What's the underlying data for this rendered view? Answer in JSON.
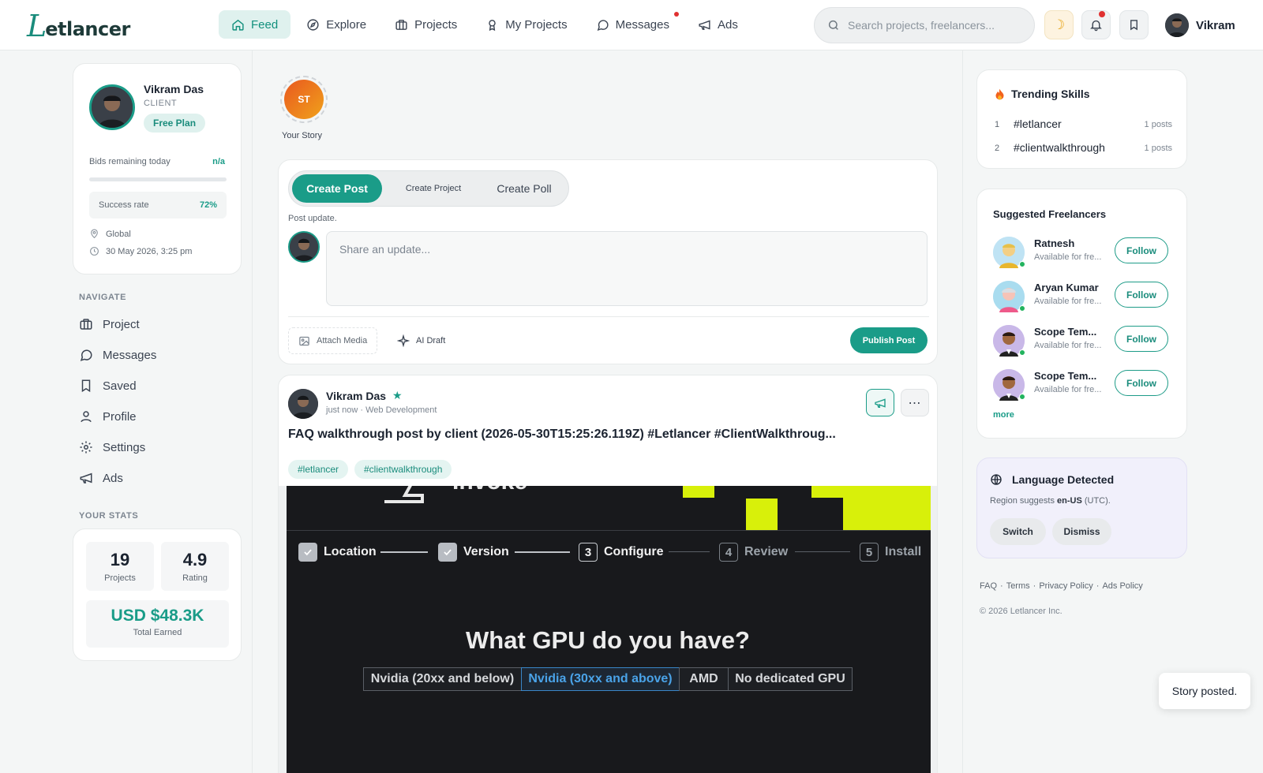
{
  "app": {
    "name": "Letlancer",
    "logo_initial": "L",
    "logo_rest": "etlancer"
  },
  "nav": {
    "items": [
      {
        "label": "Feed",
        "icon": "home-icon",
        "active": true
      },
      {
        "label": "Explore",
        "icon": "compass-icon"
      },
      {
        "label": "Projects",
        "icon": "briefcase-icon"
      },
      {
        "label": "My Projects",
        "icon": "award-icon"
      },
      {
        "label": "Messages",
        "icon": "chat-icon",
        "notification_dot": true
      },
      {
        "label": "Ads",
        "icon": "megaphone-icon"
      }
    ]
  },
  "search": {
    "placeholder": "Search projects, freelancers..."
  },
  "top_user": {
    "name": "Vikram"
  },
  "profile": {
    "name": "Vikram Das",
    "role": "CLIENT",
    "plan": "Free Plan",
    "bids_label": "Bids remaining today",
    "bids_value": "n/a",
    "success_label": "Success rate",
    "success_value": "72%",
    "location": "Global",
    "datetime": "30 May 2026, 3:25 pm"
  },
  "sidebar": {
    "navigate_title": "NAVIGATE",
    "items": [
      {
        "label": "Project",
        "icon": "briefcase-icon"
      },
      {
        "label": "Messages",
        "icon": "chat-icon"
      },
      {
        "label": "Saved",
        "icon": "bookmark-icon"
      },
      {
        "label": "Profile",
        "icon": "user-icon"
      },
      {
        "label": "Settings",
        "icon": "gear-icon"
      },
      {
        "label": "Ads",
        "icon": "megaphone-icon"
      }
    ],
    "stats_title": "YOUR STATS",
    "stats": {
      "projects_value": "19",
      "projects_label": "Projects",
      "rating_value": "4.9",
      "rating_label": "Rating",
      "earned_value": "USD $48.3K",
      "earned_label": "Total Earned"
    }
  },
  "story": {
    "initials": "ST",
    "label": "Your Story"
  },
  "composer": {
    "tabs": [
      "Create Post",
      "Create Project",
      "Create Poll"
    ],
    "hint": "Post update.",
    "placeholder": "Share an update...",
    "attach_label": "Attach Media",
    "ai_label": "AI Draft",
    "publish_label": "Publish Post"
  },
  "post": {
    "author": "Vikram Das",
    "meta": "just now · Web Development",
    "title": "FAQ walkthrough post by client (2026-05-30T15:25:26.119Z) #Letlancer #ClientWalkthroug...",
    "tags": [
      "#letlancer",
      "#clientwalkthrough"
    ],
    "image": {
      "brand_text": "Invoke",
      "steps": [
        {
          "label": "Location",
          "state": "done"
        },
        {
          "label": "Version",
          "state": "done"
        },
        {
          "num": "3",
          "label": "Configure",
          "state": "current"
        },
        {
          "num": "4",
          "label": "Review",
          "state": "todo"
        },
        {
          "num": "5",
          "label": "Install",
          "state": "todo"
        }
      ],
      "question": "What GPU do you have?",
      "options": [
        "Nvidia (20xx and below)",
        "Nvidia (30xx and above)",
        "AMD",
        "No dedicated GPU"
      ],
      "selected_option": "Nvidia (30xx and above)"
    }
  },
  "trending": {
    "title": "Trending Skills",
    "items": [
      {
        "rank": "1",
        "tag": "#letlancer",
        "count": "1 posts"
      },
      {
        "rank": "2",
        "tag": "#clientwalkthrough",
        "count": "1 posts"
      }
    ]
  },
  "suggested": {
    "title": "Suggested Freelancers",
    "items": [
      {
        "name": "Ratnesh",
        "status": "Available for fre...",
        "follow": "Follow"
      },
      {
        "name": "Aryan Kumar",
        "status": "Available for fre...",
        "follow": "Follow"
      },
      {
        "name": "Scope Tem...",
        "status": "Available for fre...",
        "follow": "Follow"
      },
      {
        "name": "Scope Tem...",
        "status": "Available for fre...",
        "follow": "Follow"
      }
    ],
    "more": "more"
  },
  "language": {
    "title": "Language Detected",
    "text_prefix": "Region suggests ",
    "locale": "en-US",
    "text_suffix": " (UTC).",
    "switch_label": "Switch",
    "dismiss_label": "Dismiss"
  },
  "footer": {
    "links": [
      "FAQ",
      "Terms",
      "Privacy Policy",
      "Ads Policy"
    ],
    "copyright": "© 2026 Letlancer Inc."
  },
  "toast": {
    "text": "Story posted."
  },
  "colors": {
    "accent": "#1a9c88",
    "accent_light": "#dff1ee",
    "danger": "#e03131",
    "lime": "#d8f00a"
  }
}
